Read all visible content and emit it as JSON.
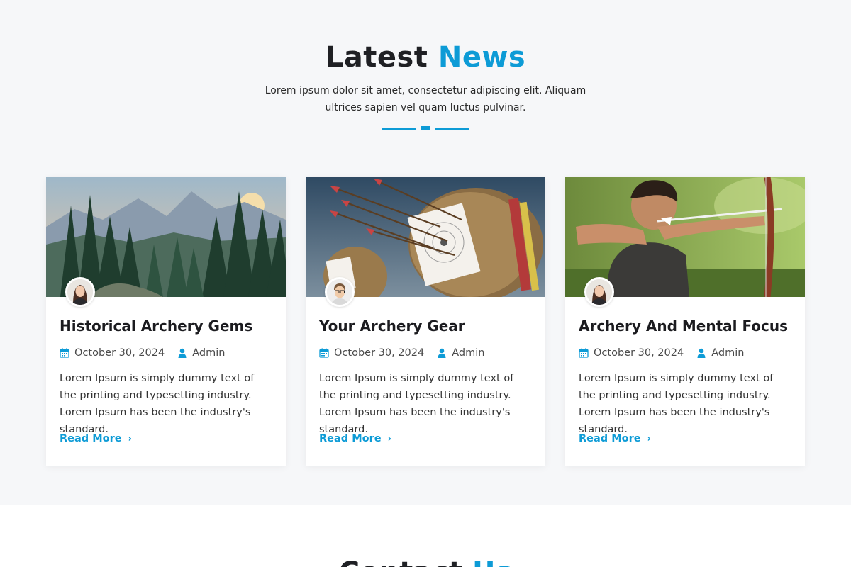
{
  "news": {
    "title_main": "Latest",
    "title_accent": "News",
    "intro": "Lorem ipsum dolor sit amet, consectetur adipiscing elit. Aliquam ultrices sapien vel quam luctus pulvinar."
  },
  "posts": [
    {
      "title": "Historical Archery Gems",
      "date": "October 30, 2024",
      "author": "Admin",
      "excerpt": "Lorem Ipsum is simply dummy text of the printing and typesetting industry. Lorem Ipsum has been the industry's standard.",
      "read_more": "Read More"
    },
    {
      "title": "Your Archery Gear",
      "date": "October 30, 2024",
      "author": "Admin",
      "excerpt": "Lorem Ipsum is simply dummy text of the printing and typesetting industry. Lorem Ipsum has been the industry's standard.",
      "read_more": "Read More"
    },
    {
      "title": "Archery And Mental Focus",
      "date": "October 30, 2024",
      "author": "Admin",
      "excerpt": "Lorem Ipsum is simply dummy text of the printing and typesetting industry. Lorem Ipsum has been the industry's standard.",
      "read_more": "Read More"
    }
  ],
  "contact": {
    "title_main": "Contact",
    "title_accent": "Us"
  },
  "icons": {
    "date": "calendar-icon",
    "author": "user-icon",
    "read_more": "chevron-right-icon"
  },
  "colors": {
    "accent": "#0d9bd6",
    "section_bg": "#f6f7f9",
    "heading": "#1f2024"
  }
}
